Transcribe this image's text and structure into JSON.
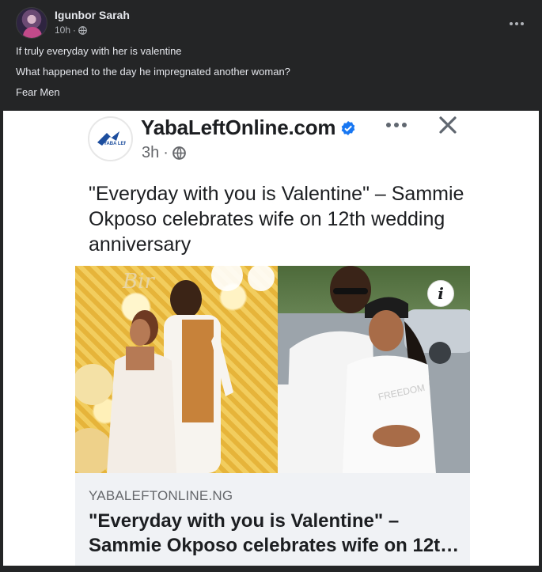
{
  "post": {
    "author": "Igunbor Sarah",
    "time": "10h",
    "separator": "·",
    "lines": [
      "If truly everyday with her is valentine",
      "What happened to the day he impregnated another woman?",
      "Fear Men"
    ]
  },
  "shared": {
    "page_name": "YabaLeftOnline.com",
    "logo_text": "YABA LEFT",
    "time": "3h",
    "separator": "·",
    "headline": "\"Everyday with you is Valentine\" – Sammie Okposo celebrates wife on 12th wedding anniversary",
    "link_domain": "YABALEFTONLINE.NG",
    "link_title_line1": "\"Everyday with you is Valentine\" –",
    "link_title_line2": "Sammie Okposo celebrates wife on 12t…",
    "info_glyph": "i",
    "photo_left_text": "Bir",
    "photo_shirt_text": "FREEDOM"
  },
  "icons": {
    "globe": "globe-icon",
    "more": "more-options-icon",
    "close": "close-icon",
    "verified": "verified-badge-icon",
    "info": "info-icon"
  },
  "colors": {
    "background": "#242526",
    "text_primary": "#e4e6eb",
    "text_secondary": "#b0b3b8",
    "verified_blue": "#1877f2"
  }
}
